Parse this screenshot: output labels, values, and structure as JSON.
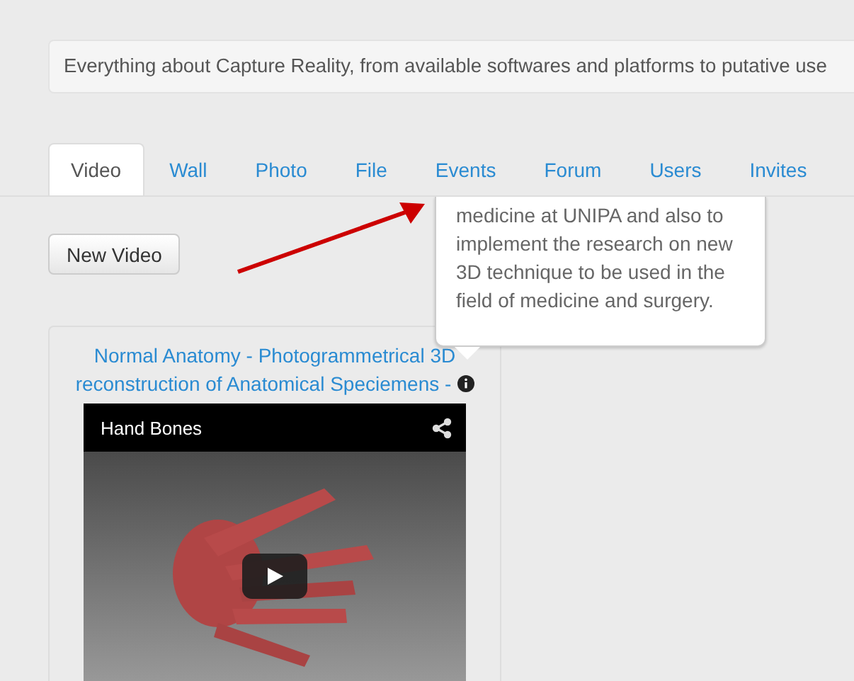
{
  "description": "Everything about Capture Reality, from available softwares and platforms to putative use",
  "tabs": [
    {
      "label": "Video",
      "selected": true
    },
    {
      "label": "Wall",
      "selected": false
    },
    {
      "label": "Photo",
      "selected": false
    },
    {
      "label": "File",
      "selected": false
    },
    {
      "label": "Events",
      "selected": false
    },
    {
      "label": "Forum",
      "selected": false
    },
    {
      "label": "Users",
      "selected": false
    },
    {
      "label": "Invites",
      "selected": false
    }
  ],
  "tooltip": {
    "lines": [
      "medicine at UNIPA and also to",
      "implement the research on new",
      "3D technique to be used in the",
      "field of medicine and surgery."
    ]
  },
  "new_button": "New Video",
  "video_card": {
    "title_lines": [
      "Normal Anatomy - Photogrammetrical 3D",
      "reconstruction of Anatomical Speciemens -"
    ],
    "player_title": "Hand Bones"
  }
}
